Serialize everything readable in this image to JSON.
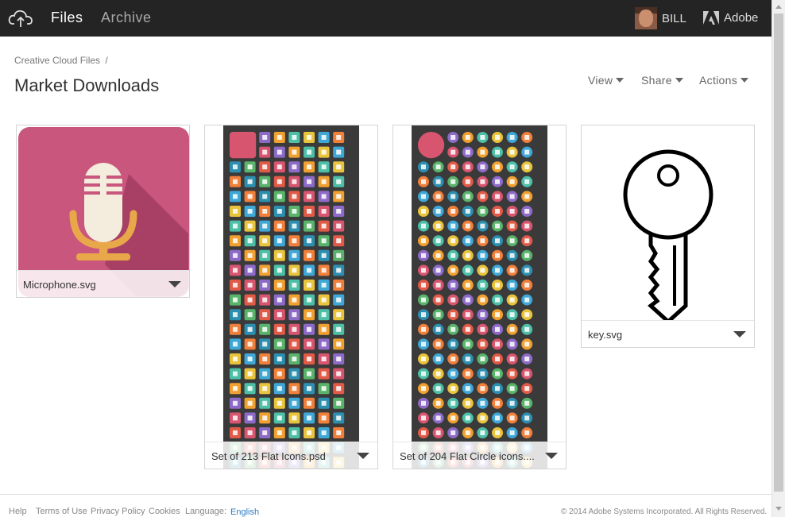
{
  "header": {
    "tabs": [
      {
        "label": "Files"
      },
      {
        "label": "Archive"
      }
    ],
    "user_name": "BILL",
    "brand_label": "Adobe"
  },
  "breadcrumb": {
    "root": "Creative Cloud Files",
    "separator": "/"
  },
  "page_title": "Market Downloads",
  "toolbar": {
    "view": "View",
    "share": "Share",
    "actions": "Actions"
  },
  "files": [
    {
      "name": "Microphone.svg"
    },
    {
      "name": "Set of 213 Flat Icons.psd"
    },
    {
      "name": "Set of 204 Flat Circle icons...."
    },
    {
      "name": "key.svg"
    }
  ],
  "footer": {
    "links": [
      "Help",
      "Terms of Use",
      "Privacy Policy",
      "Cookies"
    ],
    "language_label": "Language:",
    "language": "English",
    "copyright": "© 2014 Adobe Systems Incorporated. All Rights Reserved."
  },
  "colors": {
    "topbar": "#242424",
    "microphone_bg": "#c9567d",
    "microphone_gold": "#e8a84a",
    "link_blue": "#2c7dc0",
    "icon_sheet_bg": "#3a3a3a"
  },
  "icons": [
    "cloud-upload-icon",
    "adobe-logo-icon",
    "caret-down-icon",
    "microphone-icon",
    "key-icon"
  ]
}
